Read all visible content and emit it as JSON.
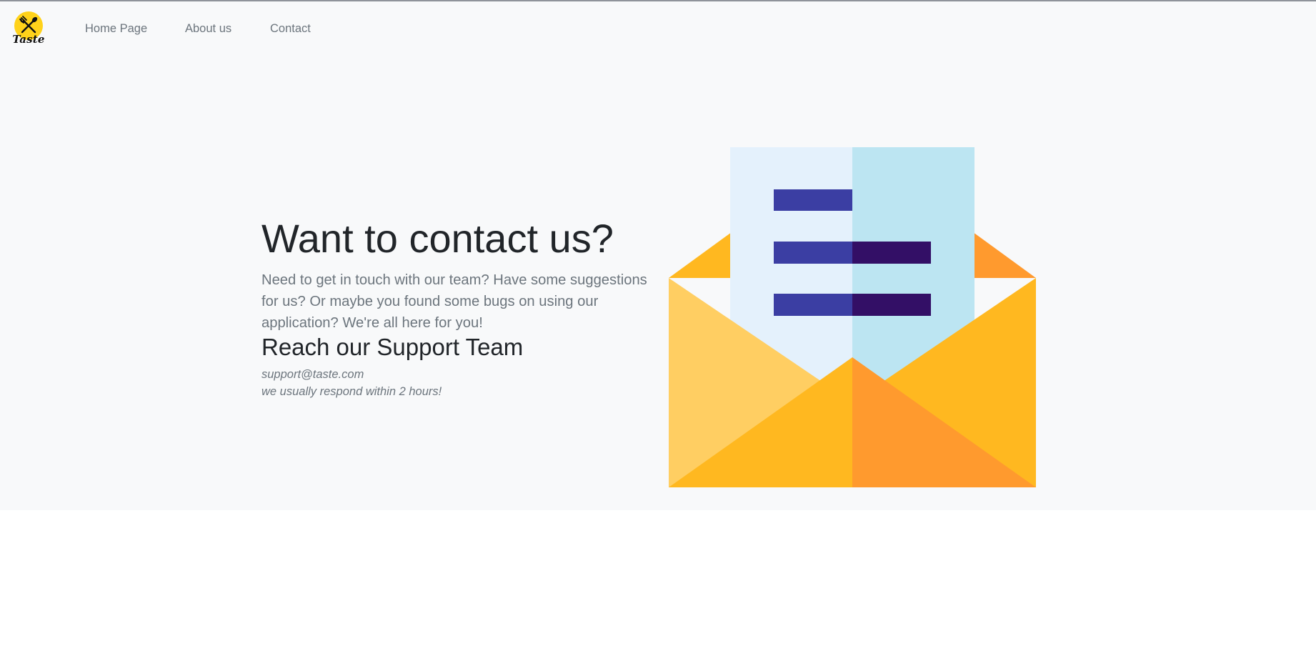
{
  "brand": {
    "logo_text": "Taste",
    "logo_color": "#ffd21a",
    "icon": "crossed-fork-spoon-icon"
  },
  "nav": {
    "links": [
      {
        "label": "Home Page"
      },
      {
        "label": "About us"
      },
      {
        "label": "Contact"
      }
    ]
  },
  "hero": {
    "title": "Want to contact us?",
    "lead": "Need to get in touch with our team? Have some suggestions for us? Or maybe you found some bugs on using our application? We're all here for you!",
    "support_heading": "Reach our Support Team",
    "support_email": "support@taste.com",
    "support_note": "we usually respond within 2 hours!",
    "illustration": "open-envelope-letter-icon"
  },
  "colors": {
    "text_dark": "#212529",
    "text_muted": "#6c757d",
    "hero_background": "#f8f9fa",
    "envelope_yellow": "#ffb820",
    "envelope_light": "#ffce62",
    "envelope_orange": "#ff9a2e",
    "letter_light": "#e4f1fc",
    "letter_blue": "#bce5f2",
    "line_indigo": "#3b3ea3",
    "line_purple": "#330f66"
  }
}
